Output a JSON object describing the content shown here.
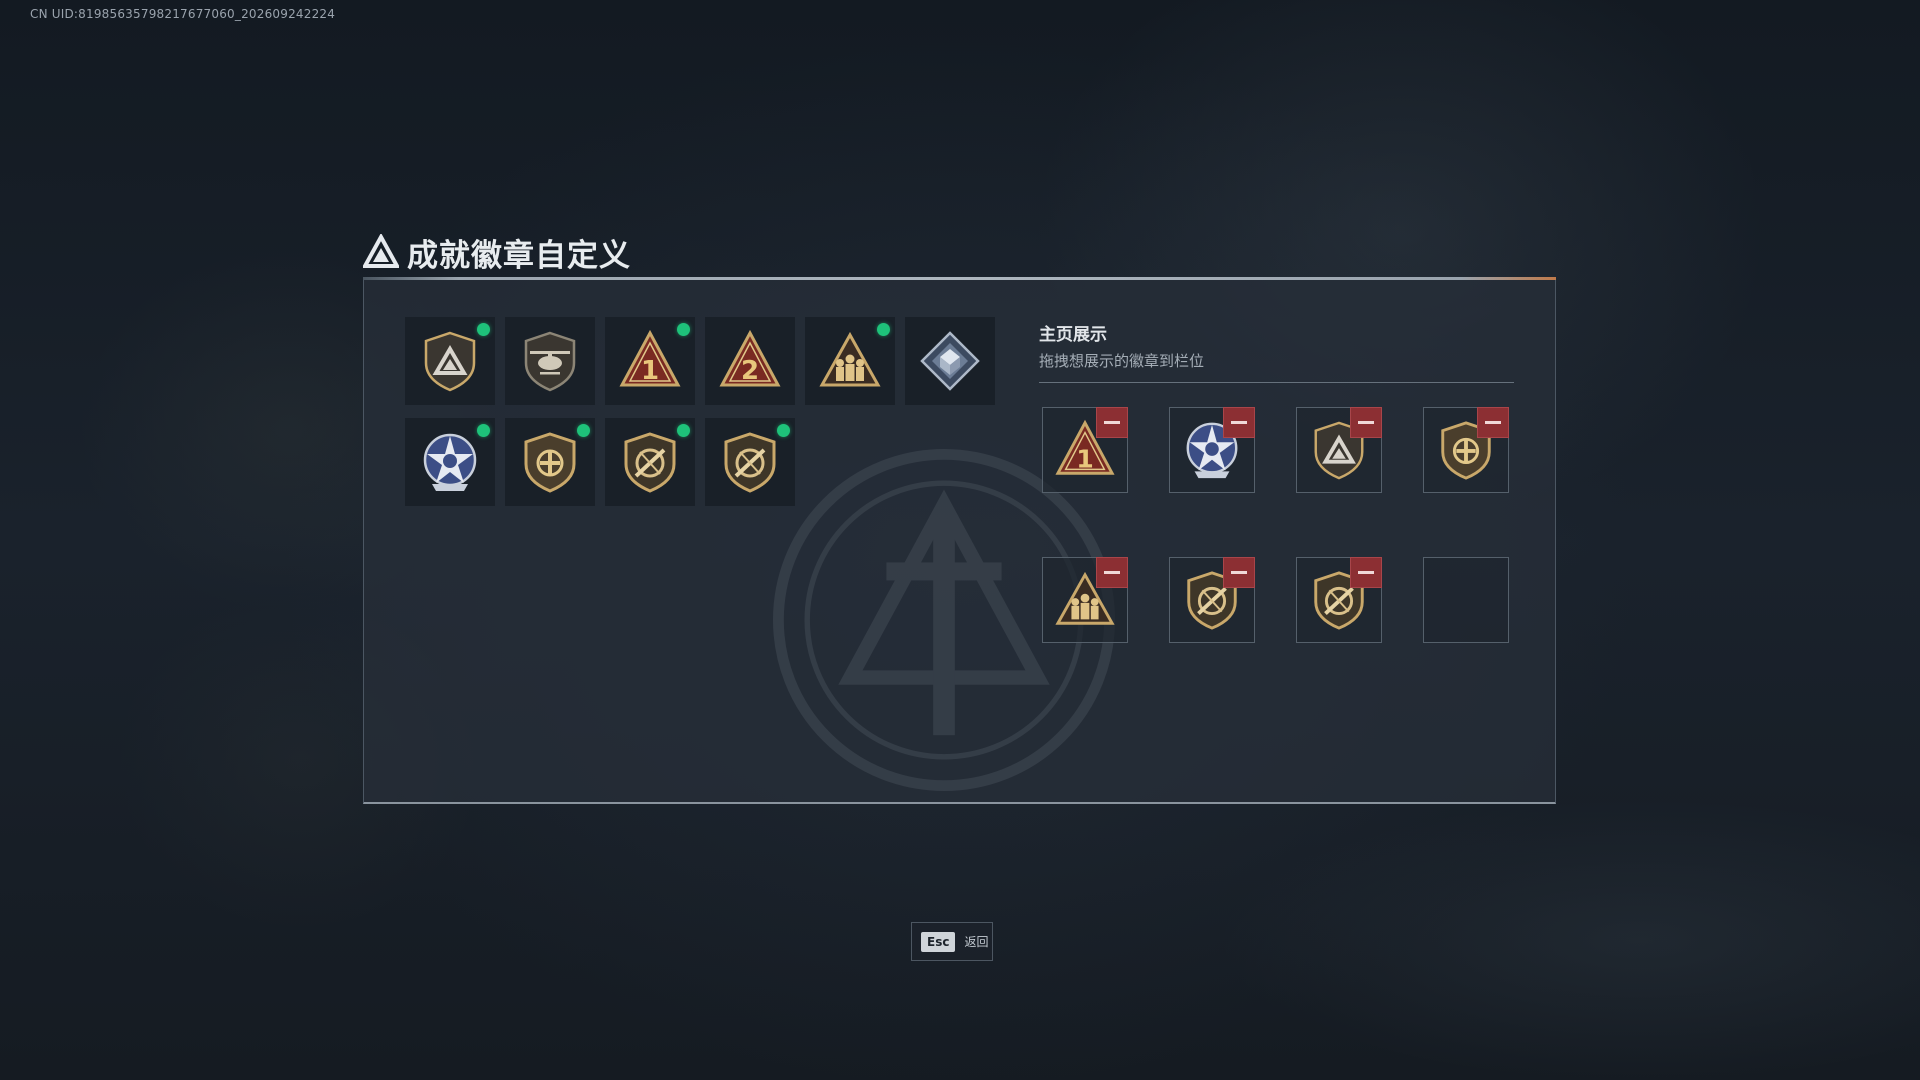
{
  "uid_text": "CN UID:8198563579821767706​0_202609242224",
  "dialog": {
    "title": "成就徽章自定义"
  },
  "inventory": [
    {
      "icon": "shield-triangle-badge-icon",
      "new": true
    },
    {
      "icon": "helicopter-badge-icon",
      "new": false
    },
    {
      "icon": "rank-one-badge-icon",
      "new": true
    },
    {
      "icon": "rank-two-badge-icon",
      "new": false
    },
    {
      "icon": "squad-soldiers-badge-icon",
      "new": true
    },
    {
      "icon": "diamond-crystal-badge-icon",
      "new": false
    },
    {
      "icon": "blue-star-emblem-icon",
      "new": true
    },
    {
      "icon": "shield-crest-badge-icon",
      "new": true
    },
    {
      "icon": "crossed-rifle-shield-icon",
      "new": true
    },
    {
      "icon": "crossed-rifle-shield-icon",
      "new": true
    }
  ],
  "showcase": {
    "title": "主页展示",
    "subtitle": "拖拽想展示的徽章到栏位",
    "slots": [
      "rank-one-badge-icon",
      "blue-star-emblem-icon",
      "shield-triangle-badge-icon",
      "shield-crest-badge-icon",
      "squad-soldiers-badge-icon",
      "crossed-rifle-shield-icon",
      "crossed-rifle-shield-icon",
      ""
    ]
  },
  "footer": {
    "key": "Esc",
    "label": "返回"
  },
  "colors": {
    "new_indicator": "#1ec27a",
    "remove_button": "#8c2f33",
    "badge_gold": "#c9a86a",
    "badge_red": "#7a2a22"
  }
}
